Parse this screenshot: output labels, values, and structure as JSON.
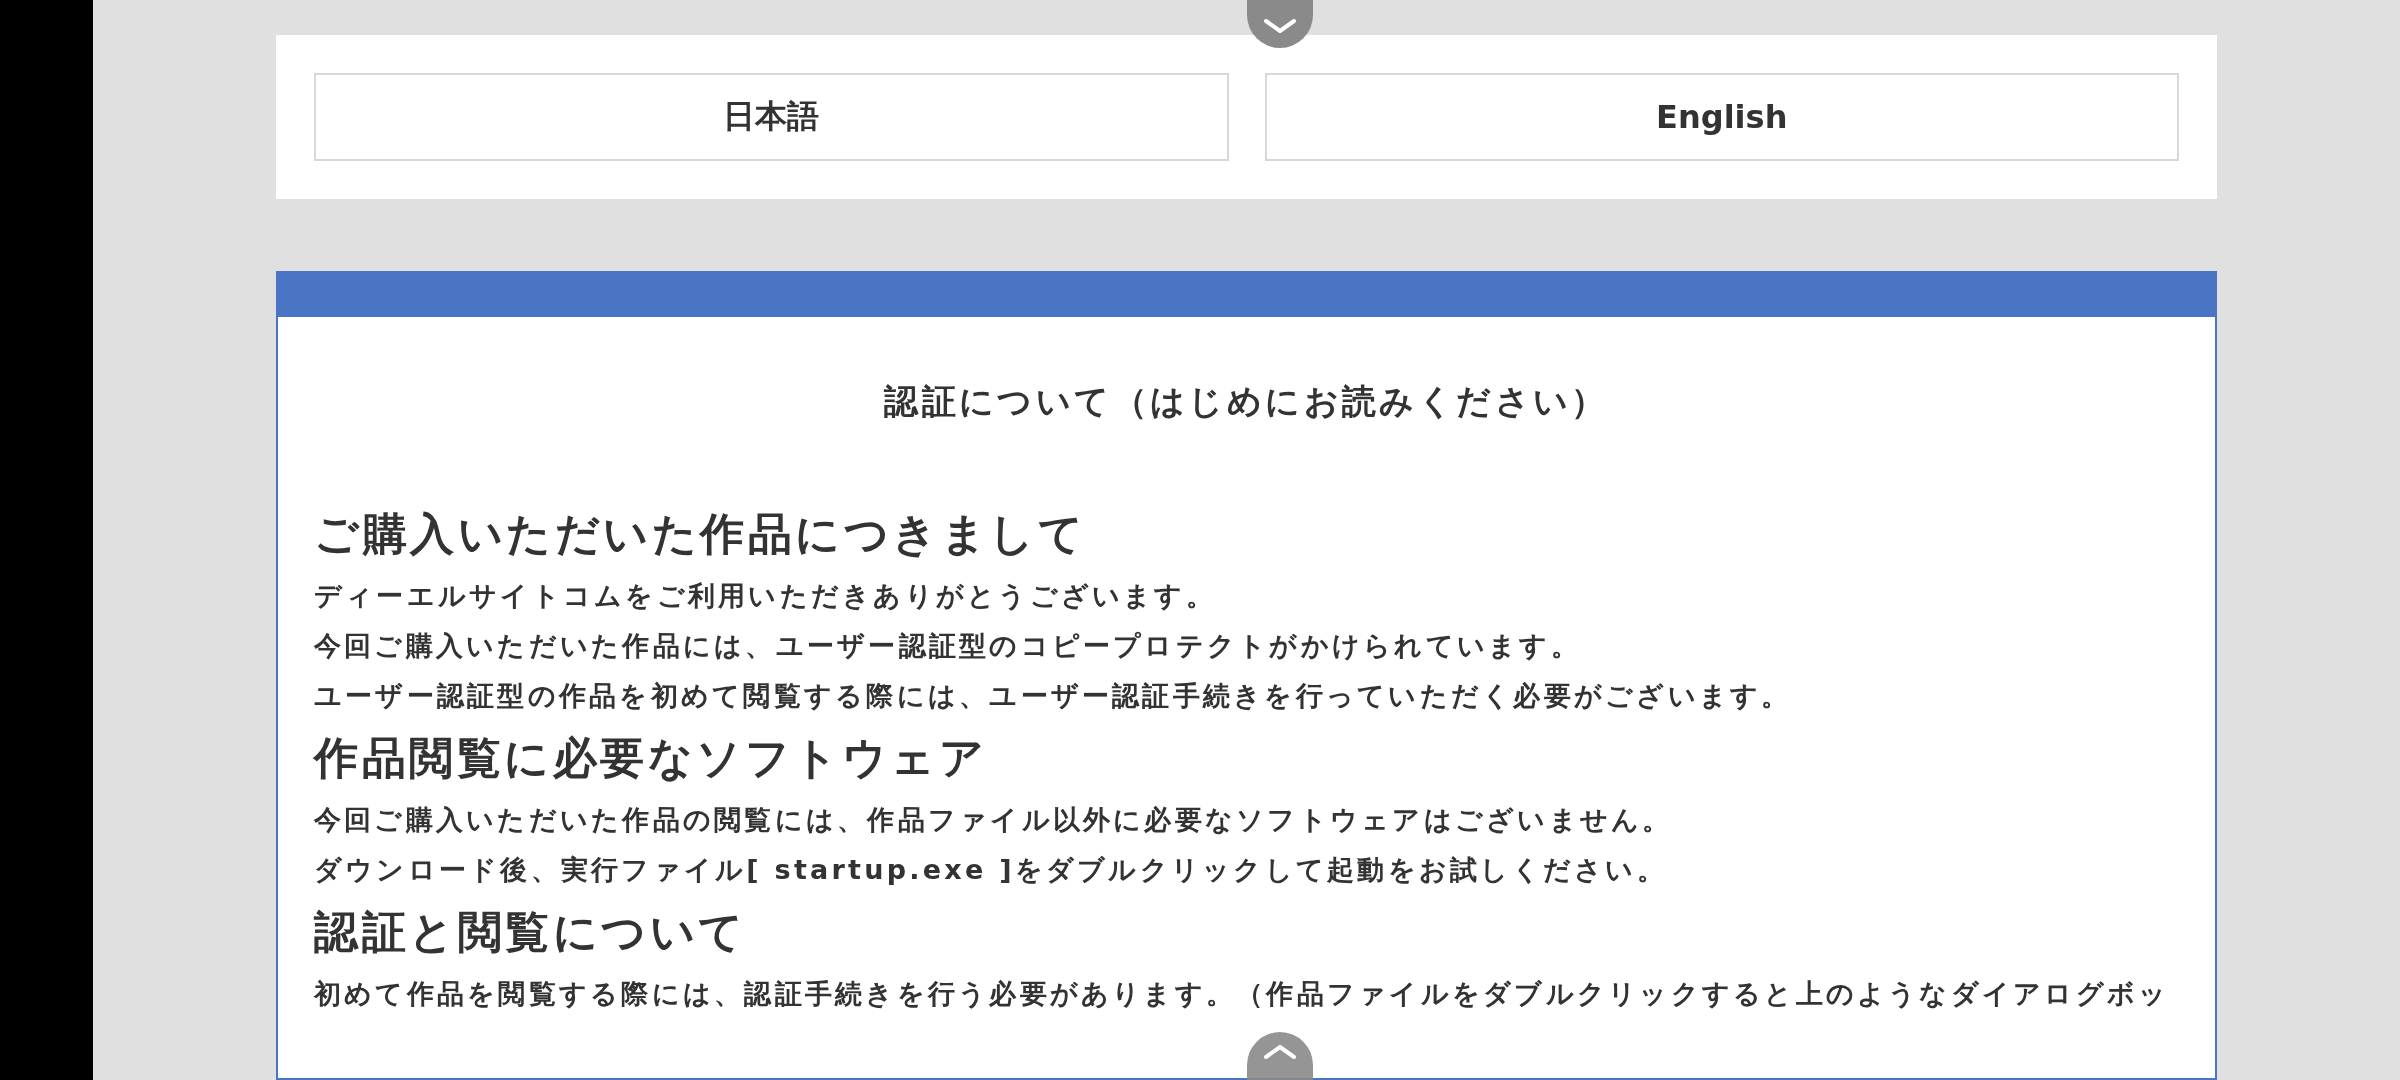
{
  "language_buttons": [
    {
      "label": "日本語"
    },
    {
      "label": "English"
    }
  ],
  "panel": {
    "title": "認証について（はじめにお読みください）",
    "sections": [
      {
        "heading": "ご購入いただいた作品につきまして",
        "paragraphs": [
          "ディーエルサイトコムをご利用いただきありがとうございます。",
          "今回ご購入いただいた作品には、ユーザー認証型のコピープロテクトがかけられています。",
          "ユーザー認証型の作品を初めて閲覧する際には、ユーザー認証手続きを行っていただく必要がございます。"
        ]
      },
      {
        "heading": "作品閲覧に必要なソフトウェア",
        "paragraphs": [
          "今回ご購入いただいた作品の閲覧には、作品ファイル以外に必要なソフトウェアはございません。",
          "ダウンロード後、実行ファイル[ **startup.exe** ]をダブルクリックして起動をお試しください。"
        ]
      },
      {
        "heading": "認証と閲覧について",
        "paragraphs": [
          "初めて作品を閲覧する際には、認証手続きを行う必要があります。（作品ファイルをダブルクリックすると上のようなダイアログボッ"
        ]
      }
    ]
  }
}
